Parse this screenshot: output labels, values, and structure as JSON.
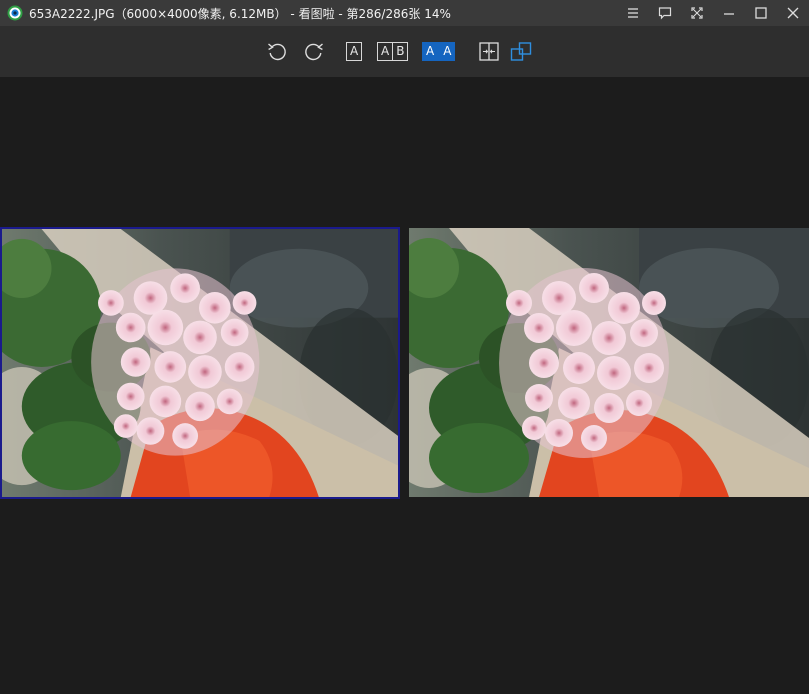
{
  "titlebar": {
    "title": "653A2222.JPG（6000×4000像素, 6.12MB） - 看图啦 - 第286/286张 14%"
  },
  "toolbar": {
    "mode_single": "A",
    "mode_ab_left": "A",
    "mode_ab_right": "B",
    "mode_aa_left": "A",
    "mode_aa_right": "A"
  },
  "colors": {
    "accent": "#1565c0",
    "selection_border": "#1a1a8c",
    "background": "#1c1c1c"
  },
  "icons": [
    "app-logo-icon",
    "menu-icon",
    "feedback-icon",
    "fullscreen-icon",
    "minimize-icon",
    "maximize-icon",
    "close-icon",
    "rotate-left-icon",
    "rotate-right-icon",
    "sync-compare-icon",
    "window-arrange-icon"
  ]
}
